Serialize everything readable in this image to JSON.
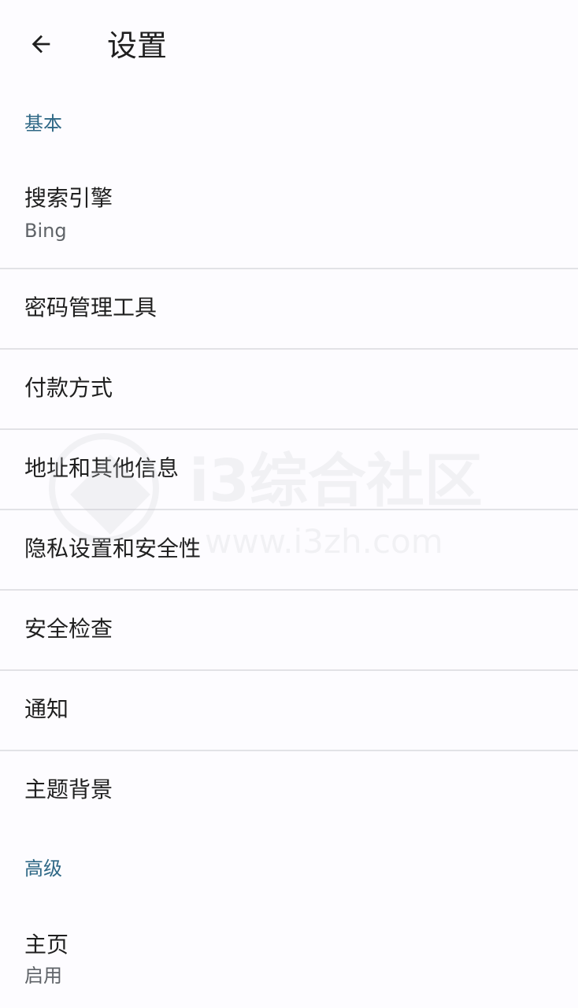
{
  "app_bar": {
    "title": "设置",
    "back_icon": "arrow-left-icon"
  },
  "sections": {
    "basic": "基本",
    "advanced": "高级"
  },
  "settings": {
    "search_engine": {
      "title": "搜索引擎",
      "value": "Bing"
    },
    "password_manager": {
      "title": "密码管理工具"
    },
    "payment_methods": {
      "title": "付款方式"
    },
    "addresses": {
      "title": "地址和其他信息"
    },
    "privacy_security": {
      "title": "隐私设置和安全性"
    },
    "safety_check": {
      "title": "安全检查"
    },
    "notifications": {
      "title": "通知"
    },
    "theme": {
      "title": "主题背景"
    },
    "homepage": {
      "title": "主页",
      "value": "启用"
    }
  },
  "watermark": {
    "brand": "i3综合社区",
    "url": "www.i3zh.com"
  },
  "colors": {
    "background": "#fdfcff",
    "section_header": "#2f6886",
    "primary_text": "#1f1f1f",
    "secondary_text": "#5f6368",
    "divider": "#e2e2e6"
  }
}
